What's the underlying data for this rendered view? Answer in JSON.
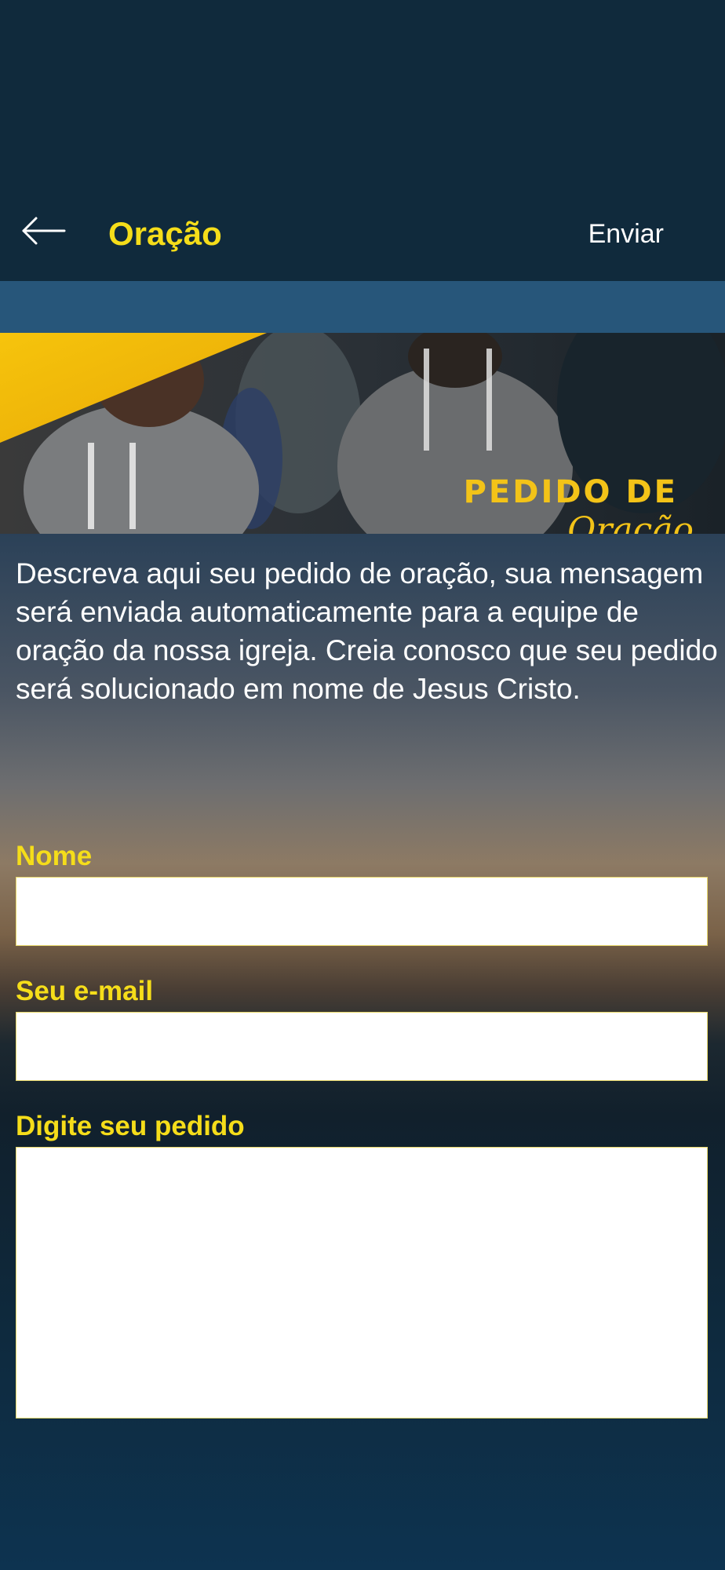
{
  "app_bar": {
    "title": "Oração",
    "send_label": "Enviar"
  },
  "banner": {
    "heading": "PEDIDO DE",
    "script_text": "Oração"
  },
  "description": "Descreva aqui seu pedido de oração, sua mensagem será enviada automaticamente para a equipe de oração da nossa igreja. Creia conosco que seu pedido será solucionado em nome de Jesus Cristo.",
  "form": {
    "name_label": "Nome",
    "name_value": "",
    "email_label": "Seu e-mail",
    "email_value": "",
    "request_label": "Digite seu pedido",
    "request_value": ""
  },
  "colors": {
    "accent": "#f5dd1a",
    "app_bar": "#102a3c",
    "sub_bar": "#27567a"
  },
  "icons": {
    "back": "arrow-left-icon"
  }
}
